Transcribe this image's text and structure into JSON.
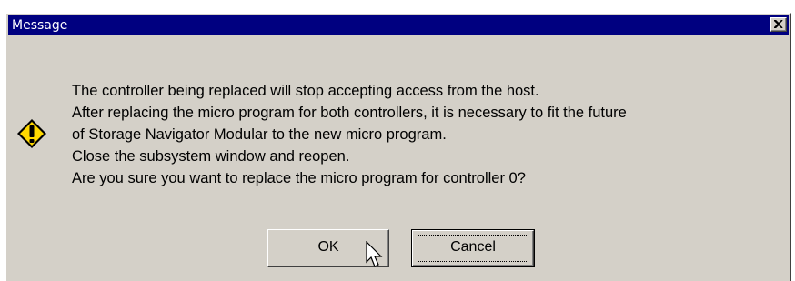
{
  "window": {
    "title": "Message"
  },
  "dialog": {
    "icon": "warning-icon",
    "message_lines": [
      "The controller being replaced will stop accepting access from the host.",
      "After replacing the micro program for both controllers, it is necessary to fit the future",
      "of Storage Navigator Modular to the new micro program.",
      "Close the subsystem window and reopen.",
      "Are you sure you want to replace the micro program for controller 0?"
    ]
  },
  "buttons": {
    "ok_label": "OK",
    "cancel_label": "Cancel"
  },
  "colors": {
    "title_bar": "#000080",
    "face": "#d4d0c8",
    "warning_fill": "#ffd800"
  }
}
